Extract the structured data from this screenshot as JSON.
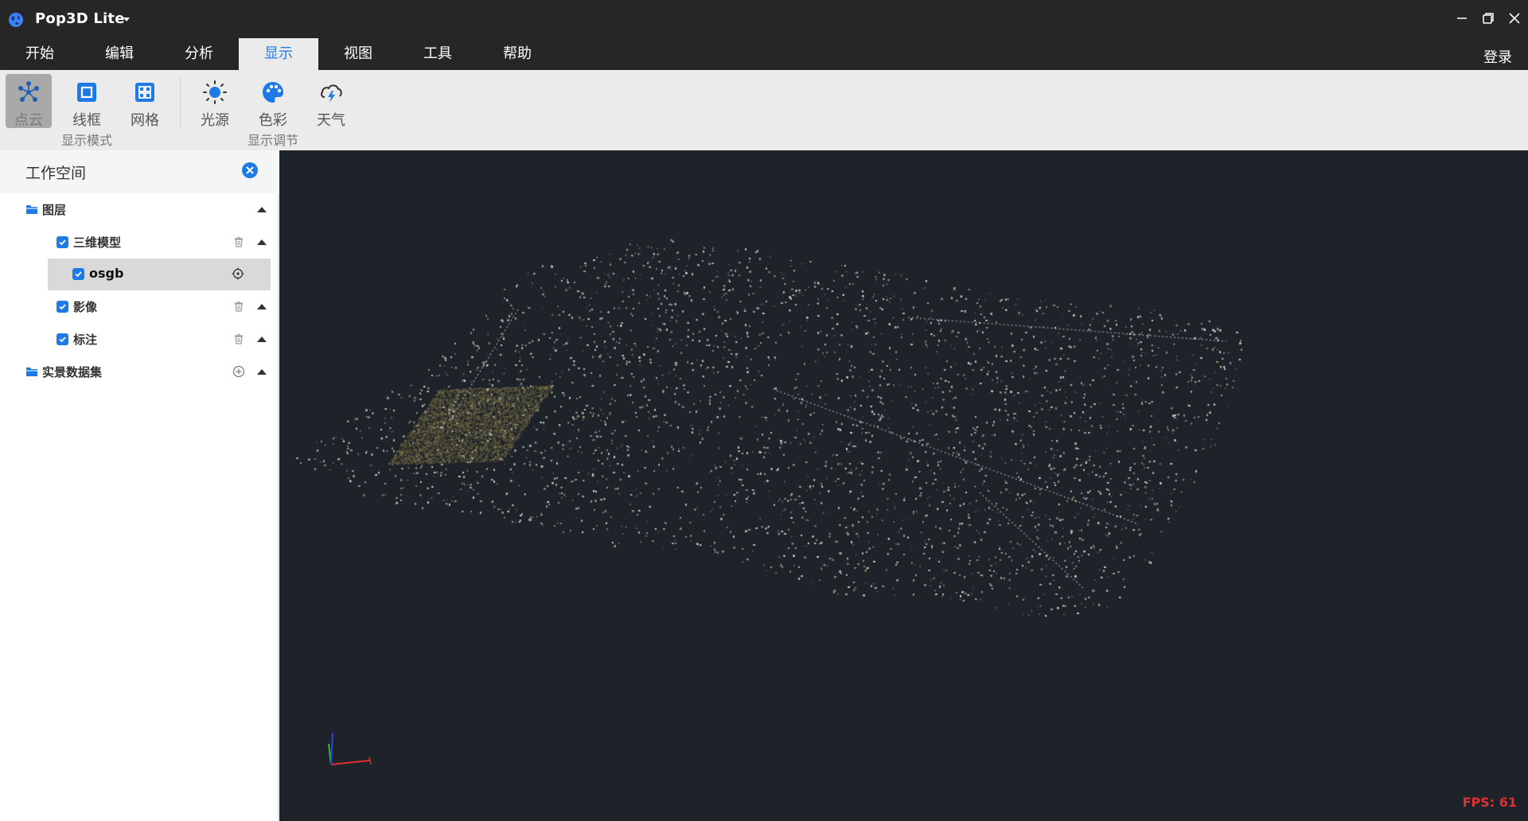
{
  "app": {
    "title": "Pop3D Lite",
    "accent_color": "#1e7be6",
    "window_controls": [
      "minimize-icon",
      "restore-icon",
      "close-icon"
    ]
  },
  "menu": {
    "tabs": [
      {
        "label": "开始",
        "active": false
      },
      {
        "label": "编辑",
        "active": false
      },
      {
        "label": "分析",
        "active": false
      },
      {
        "label": "显示",
        "active": true
      },
      {
        "label": "视图",
        "active": false
      },
      {
        "label": "工具",
        "active": false
      },
      {
        "label": "帮助",
        "active": false
      }
    ],
    "login_label": "登录"
  },
  "ribbon": {
    "groups": [
      {
        "label": "显示模式",
        "buttons": [
          {
            "label": "点云",
            "icon": "point-cloud-icon",
            "active": true
          },
          {
            "label": "线框",
            "icon": "wireframe-icon",
            "active": false
          },
          {
            "label": "网格",
            "icon": "mesh-icon",
            "active": false
          }
        ]
      },
      {
        "label": "显示调节",
        "buttons": [
          {
            "label": "光源",
            "icon": "light-source-icon",
            "active": false
          },
          {
            "label": "色彩",
            "icon": "color-palette-icon",
            "active": false
          },
          {
            "label": "天气",
            "icon": "weather-icon",
            "active": false
          }
        ]
      }
    ]
  },
  "sidebar": {
    "title": "工作空间",
    "tree": [
      {
        "label": "图层",
        "type": "folder",
        "level": 0,
        "action_icon": "",
        "collapse": true
      },
      {
        "label": "三维模型",
        "type": "layer",
        "level": 1,
        "checked": true,
        "action_icon": "trash-icon",
        "collapse": true
      },
      {
        "label": "osgb",
        "type": "layer",
        "level": 2,
        "checked": true,
        "selected": true,
        "action_icon": "locate-icon",
        "collapse": false
      },
      {
        "label": "影像",
        "type": "layer",
        "level": 1,
        "checked": true,
        "action_icon": "trash-icon",
        "collapse": true
      },
      {
        "label": "标注",
        "type": "layer",
        "level": 1,
        "checked": true,
        "action_icon": "trash-icon",
        "collapse": true
      },
      {
        "label": "实景数据集",
        "type": "folder",
        "level": 0,
        "action_icon": "add-icon",
        "collapse": true
      }
    ]
  },
  "viewport": {
    "fps_label": "FPS: 61",
    "background_color": "#1e2329"
  }
}
